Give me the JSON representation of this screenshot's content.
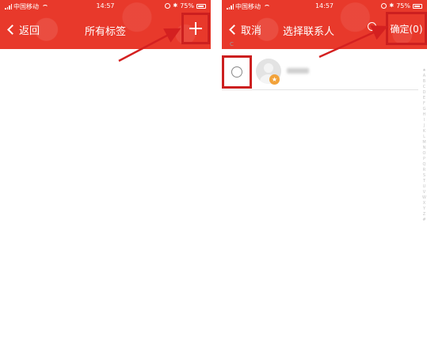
{
  "left_screen": {
    "status": {
      "carrier": "中国移动",
      "time": "14:57",
      "battery": "75%"
    },
    "nav": {
      "back_label": "返回",
      "title": "所有标签"
    }
  },
  "right_screen": {
    "status": {
      "carrier": "中国移动",
      "time": "14:57",
      "battery": "75%"
    },
    "nav": {
      "cancel_label": "取消",
      "title": "选择联系人",
      "confirm_label": "确定(0)"
    },
    "section_letter": "C",
    "index_letters": [
      "★",
      "A",
      "B",
      "C",
      "D",
      "E",
      "F",
      "G",
      "H",
      "I",
      "J",
      "K",
      "L",
      "M",
      "N",
      "O",
      "P",
      "Q",
      "R",
      "S",
      "T",
      "U",
      "V",
      "W",
      "X",
      "Y",
      "Z",
      "#"
    ]
  },
  "colors": {
    "header_red": "#e8392b",
    "annotation_red": "#cc1f1f",
    "badge_orange": "#f2a23a"
  },
  "icons": [
    "chevron-left-icon",
    "plus-icon",
    "search-icon",
    "radio-icon",
    "star-badge-icon",
    "signal-icon",
    "wifi-icon",
    "battery-icon"
  ]
}
